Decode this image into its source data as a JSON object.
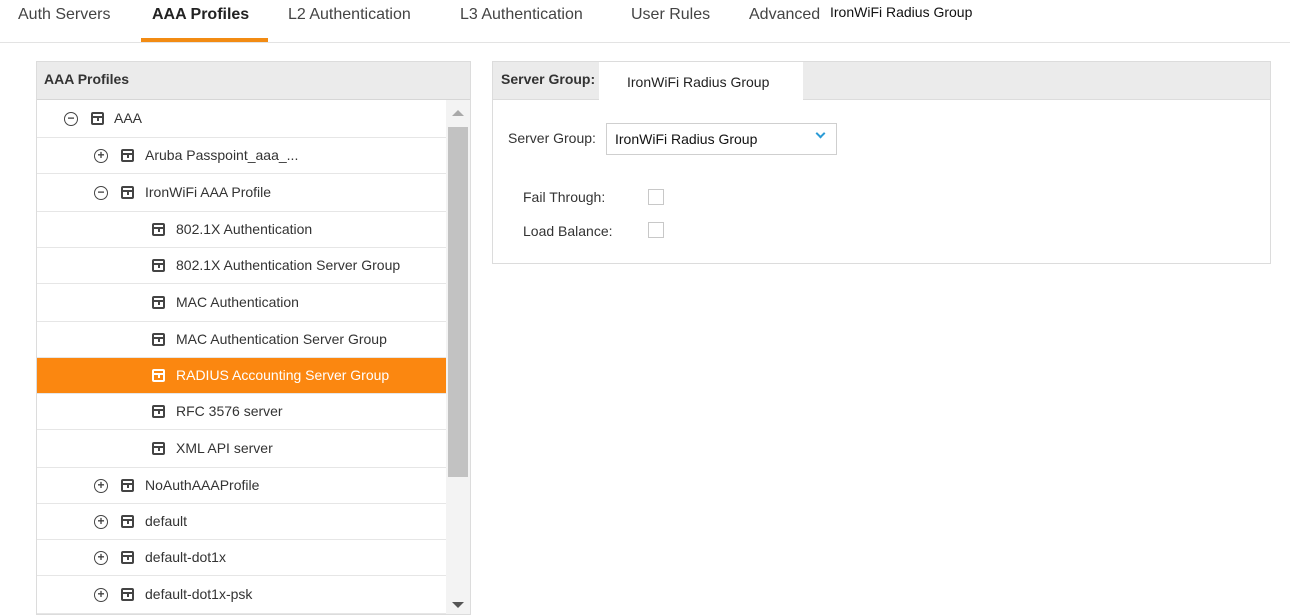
{
  "tabs": [
    {
      "label": "Auth Servers",
      "active": false
    },
    {
      "label": "AAA Profiles",
      "active": true
    },
    {
      "label": "L2 Authentication",
      "active": false
    },
    {
      "label": "L3 Authentication",
      "active": false
    },
    {
      "label": "User Rules",
      "active": false
    },
    {
      "label": "Advanced",
      "active": false
    }
  ],
  "overlay_label": "IronWiFi Radius Group",
  "accent_color": "#f28b13",
  "left_panel": {
    "title": "AAA Profiles",
    "tree": [
      {
        "label": "AAA",
        "toggle": "minus",
        "selected": false
      },
      {
        "label": "Aruba Passpoint_aaa_...",
        "toggle": "plus",
        "selected": false
      },
      {
        "label": "IronWiFi AAA Profile",
        "toggle": "minus",
        "selected": false
      },
      {
        "label": "802.1X Authentication",
        "toggle": null,
        "selected": false
      },
      {
        "label": "802.1X Authentication Server Group",
        "toggle": null,
        "selected": false
      },
      {
        "label": "MAC Authentication",
        "toggle": null,
        "selected": false
      },
      {
        "label": "MAC Authentication Server Group",
        "toggle": null,
        "selected": false
      },
      {
        "label": "RADIUS Accounting Server Group",
        "toggle": null,
        "selected": true
      },
      {
        "label": "RFC 3576 server",
        "toggle": null,
        "selected": false
      },
      {
        "label": "XML API server",
        "toggle": null,
        "selected": false
      },
      {
        "label": "NoAuthAAAProfile",
        "toggle": "plus",
        "selected": false
      },
      {
        "label": "default",
        "toggle": "plus",
        "selected": false
      },
      {
        "label": "default-dot1x",
        "toggle": "plus",
        "selected": false
      },
      {
        "label": "default-dot1x-psk",
        "toggle": "plus",
        "selected": false
      }
    ]
  },
  "right_panel": {
    "header_label": "Server Group:",
    "header_value": "IronWiFi Radius Group",
    "server_group_label": "Server Group:",
    "server_group_value": "IronWiFi Radius Group",
    "fail_through_label": "Fail Through:",
    "fail_through_checked": false,
    "load_balance_label": "Load Balance:",
    "load_balance_checked": false
  },
  "icons": {
    "toggle_plus": "⊕",
    "toggle_minus": "⊖",
    "node": "profile-node-icon"
  }
}
